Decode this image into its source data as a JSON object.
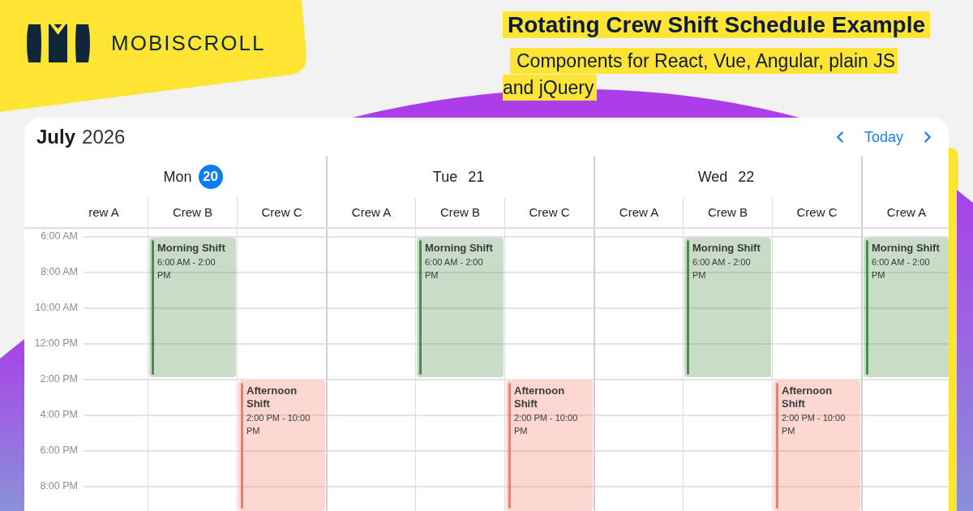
{
  "header": {
    "brand": "MOBISCROLL",
    "title": "Rotating Crew Shift Schedule Example",
    "subtitle_lines": [
      "Components for React, Vue, Angular, plain JS",
      "and jQuery"
    ]
  },
  "calendar": {
    "month": "July",
    "year": "2026",
    "today_button": "Today",
    "days": [
      {
        "weekday": "Mon",
        "date": "20",
        "today": true,
        "crews": [
          {
            "name": "rew A"
          },
          {
            "name": "Crew B",
            "shifts": [
              {
                "kind": "morning",
                "title": "Morning Shift",
                "time": "6:00 AM - 2:00 PM",
                "color": "#4a8c4a"
              }
            ]
          },
          {
            "name": "Crew C",
            "shifts": [
              {
                "kind": "afternoon",
                "title": "Afternoon Shift",
                "time": "2:00 PM - 10:00 PM",
                "color": "#f47a6a"
              }
            ]
          }
        ]
      },
      {
        "weekday": "Tue",
        "date": "21",
        "today": false,
        "crews": [
          {
            "name": "Crew A"
          },
          {
            "name": "Crew B",
            "shifts": [
              {
                "kind": "morning",
                "title": "Morning Shift",
                "time": "6:00 AM - 2:00 PM",
                "color": "#4a8c4a"
              }
            ]
          },
          {
            "name": "Crew C",
            "shifts": [
              {
                "kind": "afternoon",
                "title": "Afternoon Shift",
                "time": "2:00 PM - 10:00 PM",
                "color": "#f47a6a"
              }
            ]
          }
        ]
      },
      {
        "weekday": "Wed",
        "date": "22",
        "today": false,
        "crews": [
          {
            "name": "Crew A"
          },
          {
            "name": "Crew B",
            "shifts": [
              {
                "kind": "morning",
                "title": "Morning Shift",
                "time": "6:00 AM - 2:00 PM",
                "color": "#4a8c4a"
              }
            ]
          },
          {
            "name": "Crew C",
            "shifts": [
              {
                "kind": "afternoon",
                "title": "Afternoon Shift",
                "time": "2:00 PM - 10:00 PM",
                "color": "#f47a6a"
              }
            ]
          }
        ]
      },
      {
        "crews": [
          {
            "name": "Crew A",
            "shifts": [
              {
                "kind": "morning",
                "title": "Morning Shift",
                "time": "6:00 AM - 2:00 PM",
                "color": "#4a8c4a"
              }
            ]
          }
        ]
      }
    ],
    "time_labels": [
      "6:00 AM",
      "8:00 AM",
      "10:00 AM",
      "12:00 PM",
      "2:00 PM",
      "4:00 PM",
      "6:00 PM",
      "8:00 PM"
    ]
  }
}
